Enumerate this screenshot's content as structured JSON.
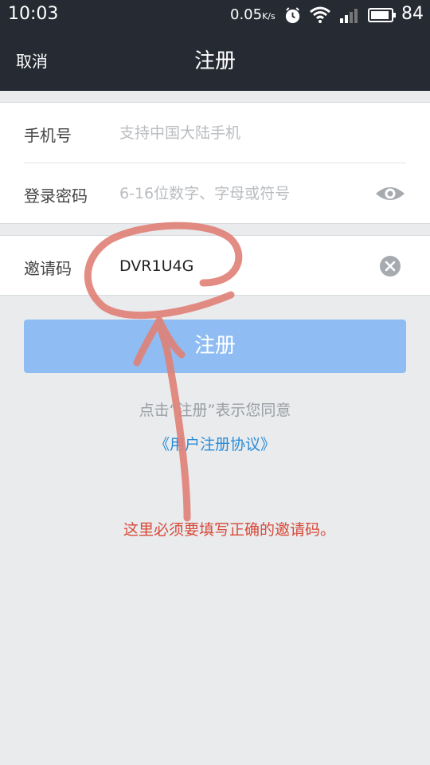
{
  "status_bar": {
    "time": "10:03",
    "net_speed": "0.05",
    "net_speed_unit": "K/s",
    "battery": "84",
    "icons": [
      "alarm-icon",
      "wifi-icon",
      "signal-icon",
      "battery-icon"
    ]
  },
  "header": {
    "cancel_label": "取消",
    "title": "注册"
  },
  "form": {
    "phone": {
      "label": "手机号",
      "placeholder": "支持中国大陆手机",
      "value": ""
    },
    "password": {
      "label": "登录密码",
      "placeholder": "6-16位数字、字母或符号",
      "value": "",
      "toggle_icon": "eye-icon"
    },
    "invite": {
      "label": "邀请码",
      "value": "DVR1U4G",
      "clear_icon": "clear-icon"
    }
  },
  "register_button": {
    "label": "注册"
  },
  "agreement": {
    "text": "点击“注册”表示您同意",
    "link": "《用户注册协议》"
  },
  "annotation": {
    "text": "这里必须要填写正确的邀请码。",
    "color": "#d84a3a"
  },
  "colors": {
    "header_bg": "#262b33",
    "page_bg": "#e9ebed",
    "button_bg": "#8fbdf3",
    "link": "#2a8bd6"
  }
}
